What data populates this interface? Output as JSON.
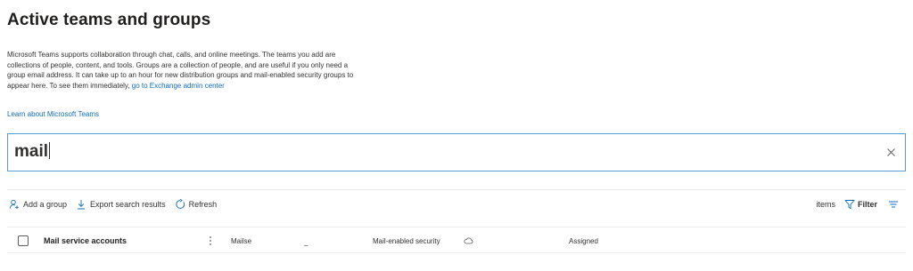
{
  "page": {
    "title": "Active teams and groups",
    "description_prefix": "Microsoft Teams supports collaboration through chat, calls, and online meetings. The teams you add are collections of people, content, and tools. Groups are a collection of people, and are useful if you only need a group email address. It can take up to an hour for new distribution groups and mail-enabled security groups to appear here. To see them immediately, ",
    "exchange_link": "go to Exchange admin center",
    "learn_link": "Learn about Microsoft Teams"
  },
  "search": {
    "value": "mail",
    "clear_icon": "close-icon"
  },
  "toolbar": {
    "add_group": "Add a group",
    "export": "Export search results",
    "refresh": "Refresh",
    "items_label": "items",
    "filter": "Filter"
  },
  "icons": {
    "add_group": "person-add-icon",
    "export": "download-icon",
    "refresh": "refresh-icon",
    "filter": "filter-icon",
    "view": "view-options-icon",
    "more": "more-vertical-icon",
    "cloud": "cloud-icon"
  },
  "colors": {
    "accent": "#0f6cbd",
    "search_border": "#5b9bd5",
    "text": "#323130"
  },
  "rows": [
    {
      "name": "Mail service accounts",
      "email": "Mailse",
      "dash": "_",
      "type": "Mail-enabled security",
      "status": "Assigned"
    }
  ]
}
